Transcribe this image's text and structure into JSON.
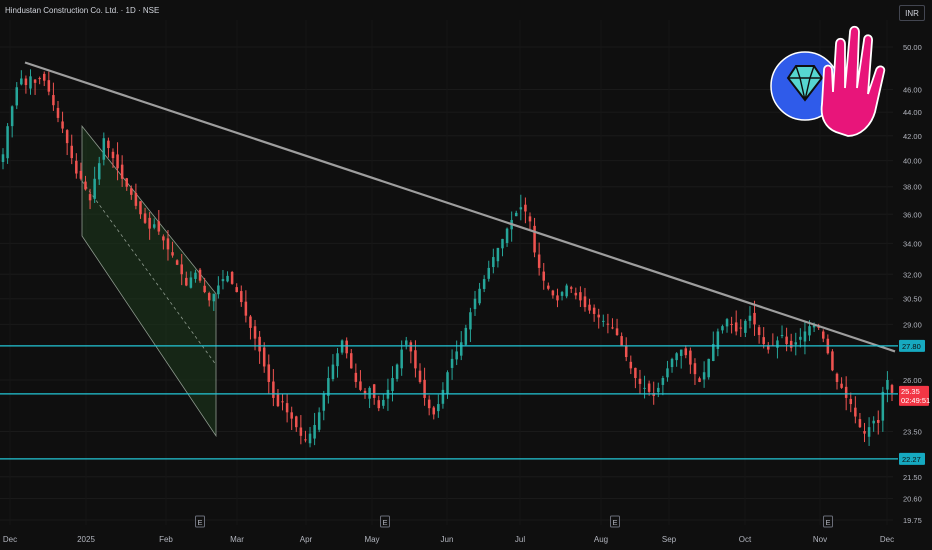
{
  "header": {
    "title": "Hindustan Construction Co. Ltd. · 1D · NSE",
    "currency": "INR"
  },
  "chart_data": {
    "type": "candlestick",
    "y_axis": {
      "scale": "log",
      "ticks": [
        50.0,
        46.0,
        44.0,
        42.0,
        40.0,
        38.0,
        36.0,
        34.0,
        32.0,
        30.5,
        29.0,
        26.0,
        23.5,
        21.5,
        20.6,
        19.75
      ]
    },
    "x_axis": {
      "ticks": [
        "Dec",
        "2025",
        "Feb",
        "Mar",
        "Apr",
        "May",
        "Jun",
        "Jul",
        "Aug",
        "Sep",
        "Oct",
        "Nov",
        "Dec"
      ]
    },
    "horizontal_levels": [
      {
        "value": 27.8,
        "label": "27.80"
      },
      {
        "value": 25.3,
        "label": "25.30"
      },
      {
        "value": 22.27,
        "label": "22.27"
      }
    ],
    "current_price": {
      "value": 25.35,
      "label": "25.35",
      "countdown": "02:49:51"
    },
    "trendline": {
      "start_value": 48.5,
      "end_value": 27.5
    },
    "channel": {
      "upper_start": 42.8,
      "upper_end": 30.8,
      "lower_start": 34.5,
      "lower_end": 23.3
    },
    "earnings_markers": [
      "E",
      "E",
      "E",
      "E"
    ],
    "colors": {
      "up": "#26a69a",
      "down": "#ef5350",
      "level_line": "#22c5d6",
      "trendline": "#9e9e9e",
      "channel_fill": "#1e3b1e",
      "price_label": "#f23645",
      "background": "#0f0f0f",
      "logo_blue": "#2f5bea",
      "logo_pink": "#e8157a",
      "logo_diamond": "#56d6d0"
    },
    "closes": [
      40.5,
      42.8,
      44.5,
      46.2,
      47.0,
      46.4,
      47.2,
      46.6,
      47.0,
      46.8,
      45.8,
      44.6,
      43.5,
      42.6,
      41.4,
      40.2,
      39.0,
      38.6,
      37.8,
      37.0,
      38.6,
      39.8,
      41.8,
      41.0,
      40.2,
      39.4,
      38.6,
      38.0,
      37.4,
      36.6,
      36.0,
      35.4,
      35.0,
      35.3,
      34.8,
      34.2,
      33.6,
      33.2,
      32.6,
      32.0,
      31.3,
      31.8,
      32.1,
      31.6,
      30.9,
      30.4,
      30.8,
      31.3,
      31.7,
      31.9,
      31.4,
      30.9,
      30.3,
      29.5,
      28.8,
      28.2,
      27.5,
      26.7,
      25.9,
      25.1,
      24.7,
      24.9,
      24.4,
      24.1,
      23.7,
      23.3,
      23.1,
      23.4,
      23.8,
      24.4,
      25.3,
      26.1,
      26.8,
      27.4,
      28.1,
      27.4,
      26.6,
      25.9,
      25.5,
      25.3,
      25.6,
      25.1,
      24.6,
      25.0,
      25.5,
      26.1,
      26.8,
      27.6,
      28.1,
      27.5,
      26.6,
      25.9,
      25.1,
      24.6,
      24.3,
      24.8,
      25.5,
      26.4,
      27.1,
      27.5,
      28.0,
      28.8,
      29.7,
      30.5,
      31.1,
      31.7,
      32.4,
      33.1,
      33.7,
      34.3,
      35.0,
      35.6,
      36.1,
      36.5,
      36.2,
      35.5,
      33.4,
      32.4,
      31.6,
      31.1,
      30.7,
      30.4,
      30.9,
      31.3,
      31.1,
      30.7,
      30.4,
      30.0,
      29.8,
      29.6,
      29.4,
      29.2,
      29.0,
      28.8,
      28.4,
      27.8,
      27.2,
      26.6,
      26.1,
      25.8,
      25.6,
      25.4,
      25.2,
      25.6,
      26.1,
      26.6,
      27.1,
      27.4,
      27.6,
      27.3,
      26.8,
      26.3,
      25.9,
      26.4,
      27.1,
      27.9,
      28.6,
      28.9,
      29.3,
      29.0,
      28.6,
      28.8,
      29.2,
      29.5,
      29.0,
      28.4,
      27.9,
      27.6,
      27.8,
      28.1,
      28.4,
      27.9,
      27.7,
      28.0,
      28.3,
      28.6,
      28.9,
      29.0,
      28.8,
      28.2,
      27.4,
      26.5,
      25.9,
      25.6,
      25.1,
      24.8,
      24.2,
      23.7,
      23.4,
      23.7,
      24.0,
      23.9,
      25.4,
      26.0,
      25.35
    ]
  }
}
